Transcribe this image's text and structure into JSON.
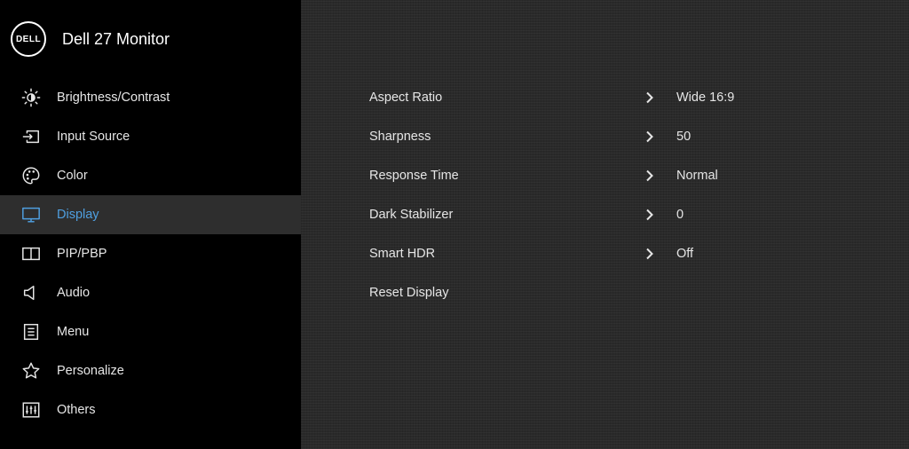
{
  "header": {
    "logo_text": "DELL",
    "title": "Dell 27 Monitor"
  },
  "sidebar": {
    "items": [
      {
        "label": "Brightness/Contrast",
        "icon": "brightness-icon"
      },
      {
        "label": "Input Source",
        "icon": "input-source-icon"
      },
      {
        "label": "Color",
        "icon": "color-palette-icon"
      },
      {
        "label": "Display",
        "icon": "monitor-icon",
        "active": true
      },
      {
        "label": "PIP/PBP",
        "icon": "pip-pbp-icon"
      },
      {
        "label": "Audio",
        "icon": "speaker-icon"
      },
      {
        "label": "Menu",
        "icon": "menu-list-icon"
      },
      {
        "label": "Personalize",
        "icon": "star-icon"
      },
      {
        "label": "Others",
        "icon": "sliders-icon"
      }
    ]
  },
  "display_settings": [
    {
      "label": "Aspect Ratio",
      "value": "Wide 16:9"
    },
    {
      "label": "Sharpness",
      "value": "50"
    },
    {
      "label": "Response Time",
      "value": "Normal"
    },
    {
      "label": "Dark Stabilizer",
      "value": "0"
    },
    {
      "label": "Smart HDR",
      "value": "Off"
    },
    {
      "label": "Reset Display",
      "value": ""
    }
  ],
  "colors": {
    "active_text": "#4f9fe0",
    "active_bg": "#2e2e2e",
    "sidebar_bg": "#000000",
    "content_bg": "#2a2a2a",
    "text": "#e6e6e6"
  }
}
